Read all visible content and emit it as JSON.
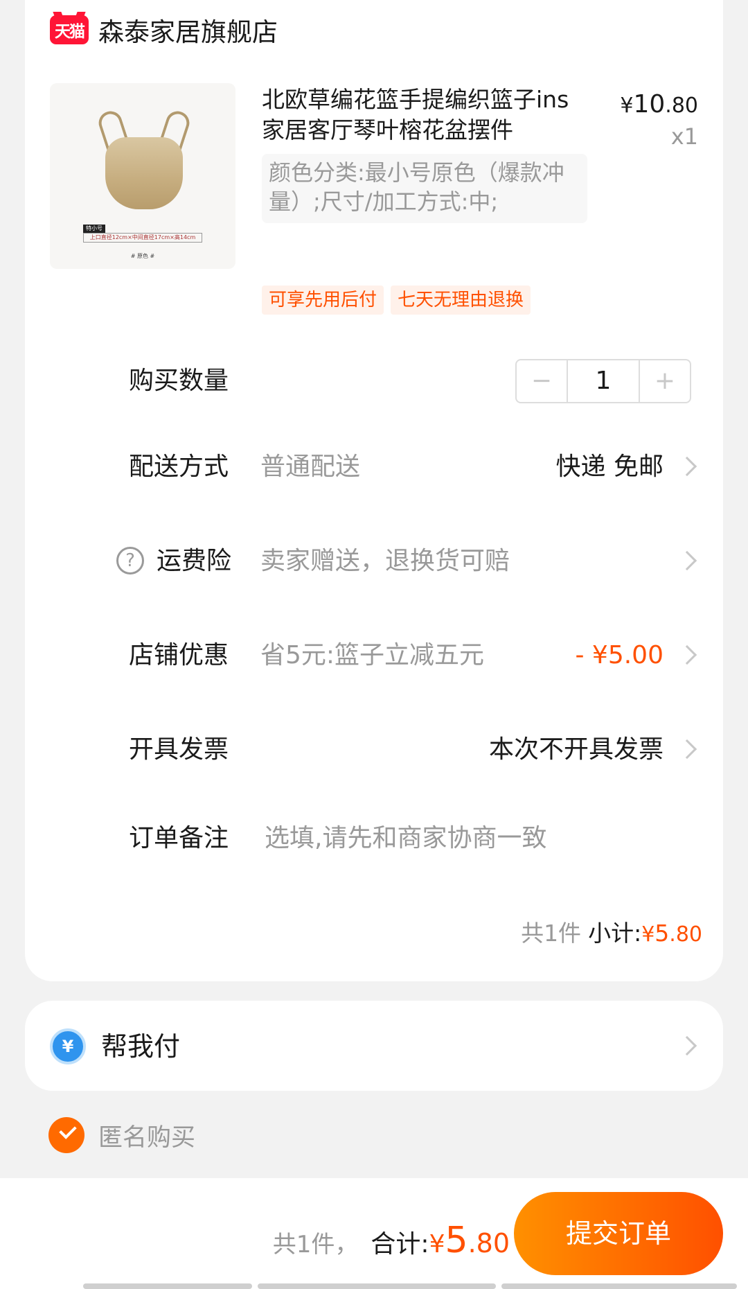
{
  "shop": {
    "logo_text": "天猫",
    "name": "森泰家居旗舰店"
  },
  "product": {
    "title": "北欧草编花篮手提编织篮子ins家居客厅琴叶榕花盆摆件",
    "price_symbol": "¥",
    "price_int": "10",
    "price_dec": ".80",
    "quantity_label": "x1",
    "sku": "颜色分类:最小号原色（爆款冲量）;尺寸/加工方式:中;",
    "image_tag": "特小号",
    "image_sizes": "上口直径12cm×中间直径17cm×高14cm",
    "image_color": "# 原色 #",
    "tags": [
      "可享先用后付",
      "七天无理由退换"
    ]
  },
  "quantity": {
    "label": "购买数量",
    "minus": "−",
    "value": "1",
    "plus": "+"
  },
  "delivery": {
    "label": "配送方式",
    "sub": "普通配送",
    "value": "快递 免邮"
  },
  "insurance": {
    "label": "运费险",
    "sub": "卖家赠送，退换货可赔",
    "icon": "?"
  },
  "shop_discount": {
    "label": "店铺优惠",
    "sub": "省5元:篮子立减五元",
    "value": "- ¥5.00"
  },
  "invoice": {
    "label": "开具发票",
    "value": "本次不开具发票"
  },
  "remark": {
    "label": "订单备注",
    "placeholder": "选填,请先和商家协商一致"
  },
  "subtotal": {
    "count": "共1件",
    "label": "小计:",
    "symbol": "¥",
    "int": "5",
    "dec": ".80"
  },
  "pay_for_me": {
    "icon": "¥",
    "label": "帮我付"
  },
  "anonymous": {
    "label": "匿名购买",
    "checked": true
  },
  "bottom": {
    "count": "共1件，",
    "label": "合计:",
    "symbol": "¥",
    "int": "5",
    "dec": ".80",
    "submit": "提交订单"
  },
  "colors": {
    "accent": "#ff5000",
    "tmall_red": "#ff1536",
    "text_gray": "#999999"
  }
}
